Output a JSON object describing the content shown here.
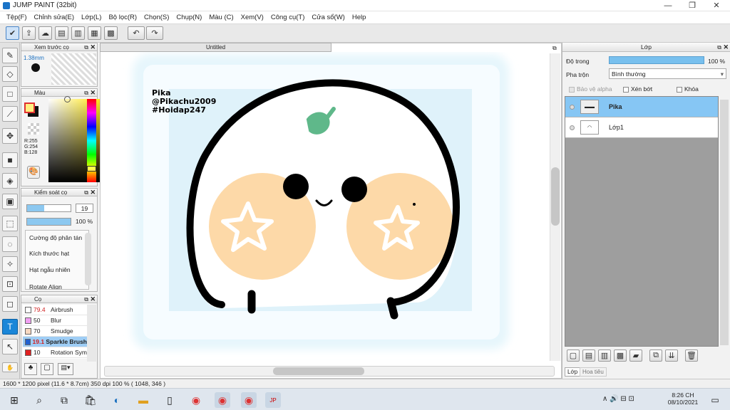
{
  "window": {
    "title": "JUMP PAINT (32bit)",
    "minimize": "—",
    "restore": "❐",
    "close": "✕"
  },
  "menu": [
    "Tệp(F)",
    "Chỉnh sửa(E)",
    "Lớp(L)",
    "Bộ lọc(R)",
    "Chọn(S)",
    "Chụp(N)",
    "Màu (C)",
    "Xem(V)",
    "Công cụ(T)",
    "Cửa sổ(W)",
    "Help"
  ],
  "brush_preview": {
    "title": "Xem trước cọ",
    "size": "1.38mm"
  },
  "color_panel": {
    "title": "Màu",
    "r": "R:255",
    "g": "G:254",
    "b": "B:128",
    "fg": "#ffef80",
    "bg": "#111111"
  },
  "brush_control": {
    "title": "Kiểm soát cọ",
    "size_value": "19",
    "opacity_value": "100 %",
    "items": [
      "Cường độ phân tán",
      "Kích thước hạt",
      "Hạt ngẫu nhiên",
      "Rotate Align"
    ]
  },
  "brush_list": {
    "title": "Cọ",
    "items": [
      {
        "size": "79.4",
        "name": "Airbrush",
        "color": "#ffffff",
        "red": true
      },
      {
        "size": "50",
        "name": "Blur",
        "color": "#f2a0f2",
        "red": false
      },
      {
        "size": "70",
        "name": "Smudge",
        "color": "#f8d8c0",
        "red": false
      },
      {
        "size": "19.1",
        "name": "Sparkle Brush",
        "color": "#2060d0",
        "red": true
      },
      {
        "size": "10",
        "name": "Rotation Sym",
        "color": "#e02020",
        "red": false
      }
    ]
  },
  "document": {
    "tab": "Untitled",
    "watermark": [
      "Pika",
      "@Pikachu2009",
      "#Hoidap247"
    ]
  },
  "layers_panel": {
    "title": "Lớp",
    "opacity_label": "Độ trong",
    "opacity_value": "100 %",
    "blend_label": "Pha trộn",
    "blend_value": "Bình thường",
    "protect_alpha": "Bảo vệ alpha",
    "clip": "Xén bớt",
    "lock": "Khóa",
    "layers": [
      {
        "name": "Pika",
        "selected": true
      },
      {
        "name": "Lớp1",
        "selected": false
      }
    ],
    "tabs": [
      "Lớp",
      "Hoa tiêu"
    ]
  },
  "status": {
    "text": "1600 * 1200 pixel   (11.6 * 8.7cm)   350 dpi   100 %   ( 1048, 346 )"
  },
  "taskbar": {
    "time": "8:26 CH",
    "date": "08/10/2021",
    "tray": "∧  🔊  ⊟  ⊡"
  }
}
